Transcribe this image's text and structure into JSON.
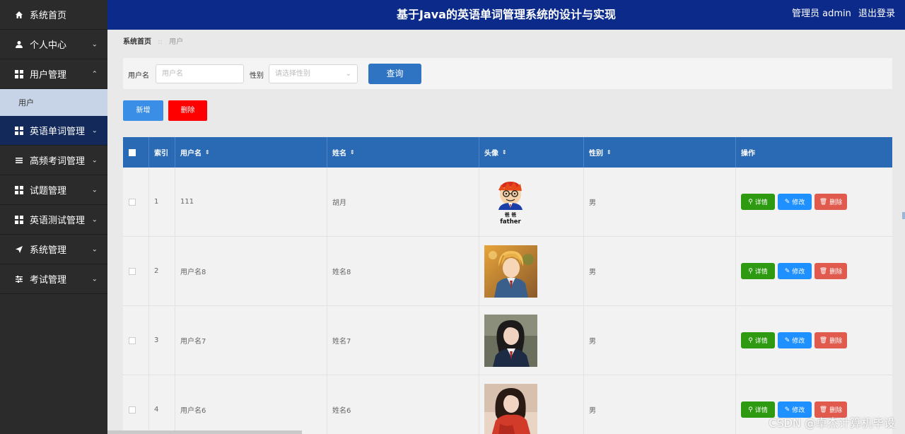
{
  "header": {
    "title": "基于Java的英语单词管理系统的设计与实现",
    "user": "管理员 admin",
    "logout": "退出登录"
  },
  "sidebar": {
    "items": [
      {
        "label": "系统首页",
        "icon": "home-icon"
      },
      {
        "label": "个人中心",
        "icon": "user-icon"
      },
      {
        "label": "用户管理",
        "icon": "grid-icon",
        "expanded": true
      },
      {
        "label": "用户",
        "sub": true
      },
      {
        "label": "英语单词管理",
        "icon": "grid-icon",
        "active": true
      },
      {
        "label": "高频考词管理",
        "icon": "list-icon"
      },
      {
        "label": "试题管理",
        "icon": "grid-icon"
      },
      {
        "label": "英语测试管理",
        "icon": "grid-icon"
      },
      {
        "label": "系统管理",
        "icon": "send-icon"
      },
      {
        "label": "考试管理",
        "icon": "sliders-icon"
      }
    ]
  },
  "breadcrumb": {
    "home": "系统首页",
    "current": "用户"
  },
  "search": {
    "username_label": "用户名",
    "username_placeholder": "用户名",
    "gender_label": "性别",
    "gender_placeholder": "请选择性别",
    "query": "查询"
  },
  "actions": {
    "add": "新增",
    "delete": "删除"
  },
  "table": {
    "headers": [
      "索引",
      "用户名",
      "姓名",
      "头像",
      "性别",
      "操作"
    ],
    "rows": [
      {
        "index": "1",
        "username": "111",
        "name": "胡月",
        "gender": "男",
        "avatar_text": "father",
        "avatar_text2": "爸 爸"
      },
      {
        "index": "2",
        "username": "用户名8",
        "name": "姓名8",
        "gender": "男"
      },
      {
        "index": "3",
        "username": "用户名7",
        "name": "姓名7",
        "gender": "男"
      },
      {
        "index": "4",
        "username": "用户名6",
        "name": "姓名6",
        "gender": "男"
      }
    ],
    "ops": {
      "detail": "详情",
      "edit": "修改",
      "delete": "删除"
    }
  },
  "watermark": "CSDN @卓杰计算机毕设"
}
